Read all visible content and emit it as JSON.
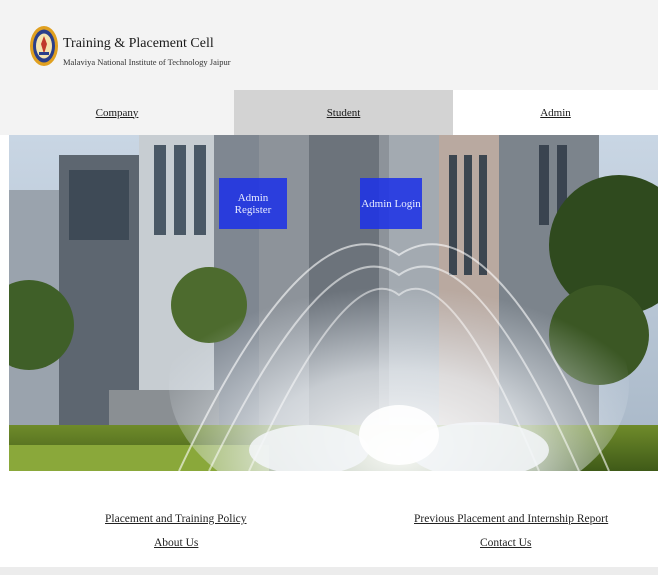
{
  "header": {
    "title": "Training & Placement Cell",
    "subtitle": "Malaviya National Institute of Technology Jaipur",
    "logo_icon": "institute-seal-icon"
  },
  "nav": {
    "company": "Company",
    "student": "Student",
    "admin": "Admin",
    "active": "Student"
  },
  "hero": {
    "register_label": "Admin Register",
    "login_label": "Admin Login",
    "button_color": "#1e32e6"
  },
  "footer": {
    "policy": "Placement and Training Policy",
    "about": "About Us",
    "report": "Previous Placement and Internship Report",
    "contact": "Contact Us"
  }
}
